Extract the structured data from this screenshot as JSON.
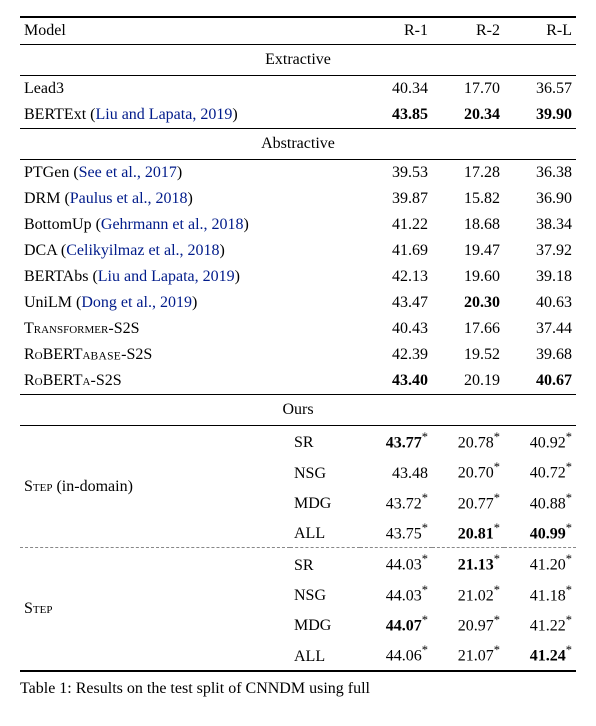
{
  "headers": {
    "model": "Model",
    "r1": "R-1",
    "r2": "R-2",
    "rl": "R-L"
  },
  "sections": {
    "extractive": "Extractive",
    "abstractive": "Abstractive",
    "ours": "Ours"
  },
  "extractive": [
    {
      "name": "Lead3",
      "cite": "",
      "r1": "40.34",
      "r2": "17.70",
      "rl": "36.57"
    },
    {
      "name": "BERTExt",
      "cite": "Liu and Lapata, 2019",
      "r1": "43.85",
      "r2": "20.34",
      "rl": "39.90",
      "b1": true,
      "b2": true,
      "bl": true
    }
  ],
  "abstractive": [
    {
      "name": "PTGen",
      "cite": "See et al., 2017",
      "r1": "39.53",
      "r2": "17.28",
      "rl": "36.38"
    },
    {
      "name": "DRM",
      "cite": "Paulus et al., 2018",
      "r1": "39.87",
      "r2": "15.82",
      "rl": "36.90"
    },
    {
      "name": "BottomUp",
      "cite": "Gehrmann et al., 2018",
      "r1": "41.22",
      "r2": "18.68",
      "rl": "38.34"
    },
    {
      "name": "DCA",
      "cite": "Celikyilmaz et al., 2018",
      "r1": "41.69",
      "r2": "19.47",
      "rl": "37.92"
    },
    {
      "name": "BERTAbs",
      "cite": "Liu and Lapata, 2019",
      "r1": "42.13",
      "r2": "19.60",
      "rl": "39.18"
    },
    {
      "name": "UniLM",
      "cite": "Dong et al., 2019",
      "r1": "43.47",
      "r2": "20.30",
      "rl": "40.63",
      "b2": true
    },
    {
      "sc": "Transformer",
      "suffix": "-S2S",
      "r1": "40.43",
      "r2": "17.66",
      "rl": "37.44"
    },
    {
      "sc": "RoBERTa",
      "sub": "BASE",
      "suffix": "-S2S",
      "r1": "42.39",
      "r2": "19.52",
      "rl": "39.68"
    },
    {
      "sc": "RoBERTa",
      "suffix": "-S2S",
      "r1": "43.40",
      "r2": "20.19",
      "rl": "40.67",
      "b1": true,
      "bl": true
    }
  ],
  "ours": {
    "group1": {
      "label": "Step",
      "label_suffix": " (in-domain)",
      "rows": [
        {
          "v": "SR",
          "r1": "43.77",
          "r2": "20.78",
          "rl": "40.92",
          "s1": true,
          "s2": true,
          "sl": true,
          "b1": true
        },
        {
          "v": "NSG",
          "r1": "43.48",
          "r2": "20.70",
          "rl": "40.72",
          "s2": true,
          "sl": true
        },
        {
          "v": "MDG",
          "r1": "43.72",
          "r2": "20.77",
          "rl": "40.88",
          "s1": true,
          "s2": true,
          "sl": true
        },
        {
          "v": "ALL",
          "r1": "43.75",
          "r2": "20.81",
          "rl": "40.99",
          "s1": true,
          "s2": true,
          "sl": true,
          "b2": true,
          "bl": true
        }
      ]
    },
    "group2": {
      "label": "Step",
      "rows": [
        {
          "v": "SR",
          "r1": "44.03",
          "r2": "21.13",
          "rl": "41.20",
          "s1": true,
          "s2": true,
          "sl": true,
          "b2": true
        },
        {
          "v": "NSG",
          "r1": "44.03",
          "r2": "21.02",
          "rl": "41.18",
          "s1": true,
          "s2": true,
          "sl": true
        },
        {
          "v": "MDG",
          "r1": "44.07",
          "r2": "20.97",
          "rl": "41.22",
          "s1": true,
          "s2": true,
          "sl": true,
          "b1": true
        },
        {
          "v": "ALL",
          "r1": "44.06",
          "r2": "21.07",
          "rl": "41.24",
          "s1": true,
          "s2": true,
          "sl": true,
          "bl": true
        }
      ]
    }
  },
  "caption_prefix": "Table 1: ",
  "caption_rest": "Results on the test split of CNNDM using full"
}
